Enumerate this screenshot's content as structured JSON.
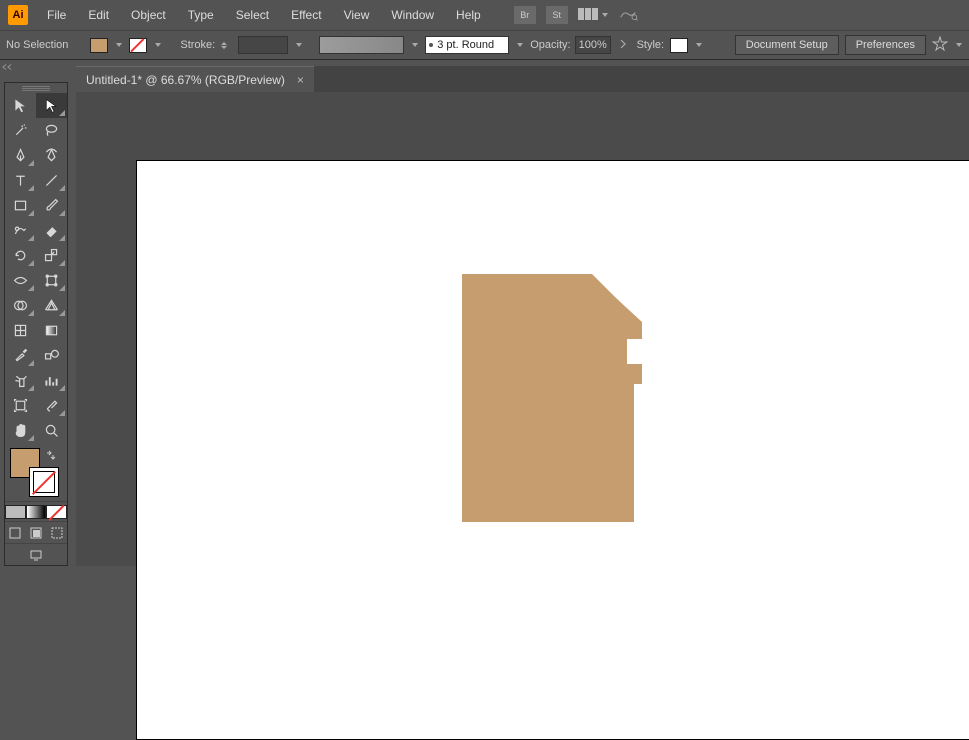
{
  "app": {
    "logo": "Ai"
  },
  "menu": [
    "File",
    "Edit",
    "Object",
    "Type",
    "Select",
    "Effect",
    "View",
    "Window",
    "Help"
  ],
  "menu_right": {
    "br": "Br",
    "st": "St"
  },
  "controlbar": {
    "selection": "No Selection",
    "fill_color": "#c69d6e",
    "stroke_label": "Stroke:",
    "brush_profile": "",
    "brush_preset": "3 pt. Round",
    "opacity_label": "Opacity:",
    "opacity_value": "100%",
    "style_label": "Style:",
    "doc_setup": "Document Setup",
    "prefs": "Preferences"
  },
  "tab": {
    "title": "Untitled-1* @ 66.67% (RGB/Preview)"
  },
  "tools": [
    [
      "selection",
      "direct-selection"
    ],
    [
      "magic-wand",
      "lasso"
    ],
    [
      "pen",
      "curvature"
    ],
    [
      "type",
      "line"
    ],
    [
      "rectangle",
      "paintbrush"
    ],
    [
      "shaper",
      "eraser"
    ],
    [
      "rotate",
      "scale"
    ],
    [
      "width",
      "free-transform"
    ],
    [
      "shape-builder",
      "perspective"
    ],
    [
      "mesh",
      "gradient"
    ],
    [
      "eyedropper",
      "blend"
    ],
    [
      "symbol-sprayer",
      "column-graph"
    ],
    [
      "artboard",
      "slice"
    ],
    [
      "hand",
      "zoom"
    ]
  ],
  "artboard": {
    "shape_color": "#c69d6e"
  }
}
